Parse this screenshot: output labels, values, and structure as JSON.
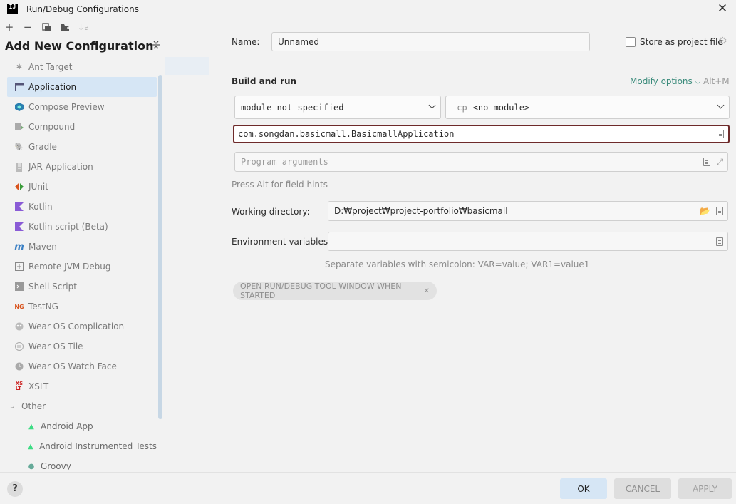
{
  "window": {
    "title": "Run/Debug Configurations",
    "logo_text": "IJ"
  },
  "toolbar": {
    "add": "+",
    "remove": "−",
    "copy": "⧉",
    "folder": "▆",
    "sort": "↓a"
  },
  "left_panel": {
    "header": "Add New Configuration",
    "items": [
      {
        "label": "Ant Target",
        "icon": "ant-icon"
      },
      {
        "label": "Application",
        "icon": "application-icon",
        "selected": true
      },
      {
        "label": "Compose Preview",
        "icon": "compose-icon"
      },
      {
        "label": "Compound",
        "icon": "compound-icon"
      },
      {
        "label": "Gradle",
        "icon": "gradle-icon"
      },
      {
        "label": "JAR Application",
        "icon": "jar-icon"
      },
      {
        "label": "JUnit",
        "icon": "junit-icon"
      },
      {
        "label": "Kotlin",
        "icon": "kotlin-icon"
      },
      {
        "label": "Kotlin script (Beta)",
        "icon": "kotlin-script-icon"
      },
      {
        "label": "Maven",
        "icon": "maven-icon"
      },
      {
        "label": "Remote JVM Debug",
        "icon": "remote-debug-icon"
      },
      {
        "label": "Shell Script",
        "icon": "shell-icon"
      },
      {
        "label": "TestNG",
        "icon": "testng-icon"
      },
      {
        "label": "Wear OS Complication",
        "icon": "wear-complication-icon"
      },
      {
        "label": "Wear OS Tile",
        "icon": "wear-tile-icon"
      },
      {
        "label": "Wear OS Watch Face",
        "icon": "wear-watchface-icon"
      },
      {
        "label": "XSLT",
        "icon": "xslt-icon"
      }
    ],
    "group": {
      "label": "Other",
      "children": [
        {
          "label": "Android App",
          "icon": "android-icon"
        },
        {
          "label": "Android Instrumented Tests",
          "icon": "android-test-icon"
        },
        {
          "label": "Groovy",
          "icon": "groovy-icon"
        }
      ]
    }
  },
  "form": {
    "name_label": "Name:",
    "name_value": "Unnamed",
    "store_label": "Store as project file",
    "section": "Build and run",
    "modify_options": "Modify options",
    "modify_shortcut": "Alt+M",
    "module_value": "module not specified",
    "cp_prefix": "-cp",
    "cp_value": "<no module>",
    "main_class": "com.songdan.basicmall.BasicmallApplication",
    "program_args_placeholder": "Program arguments",
    "field_hint": "Press Alt for field hints",
    "workdir_label": "Working directory:",
    "workdir_value": "D:₩project₩project-portfolio₩basicmall",
    "env_label": "Environment variables:",
    "env_value": "",
    "env_hint": "Separate variables with semicolon: VAR=value; VAR1=value1",
    "open_tool_window": "OPEN RUN/DEBUG TOOL WINDOW WHEN STARTED"
  },
  "buttons": {
    "help": "?",
    "ok": "OK",
    "cancel": "CANCEL",
    "apply": "APPLY"
  },
  "colors": {
    "accent": "#3c8c7c",
    "selection": "#d6e6f5",
    "focus_border": "#6e2a2a"
  }
}
